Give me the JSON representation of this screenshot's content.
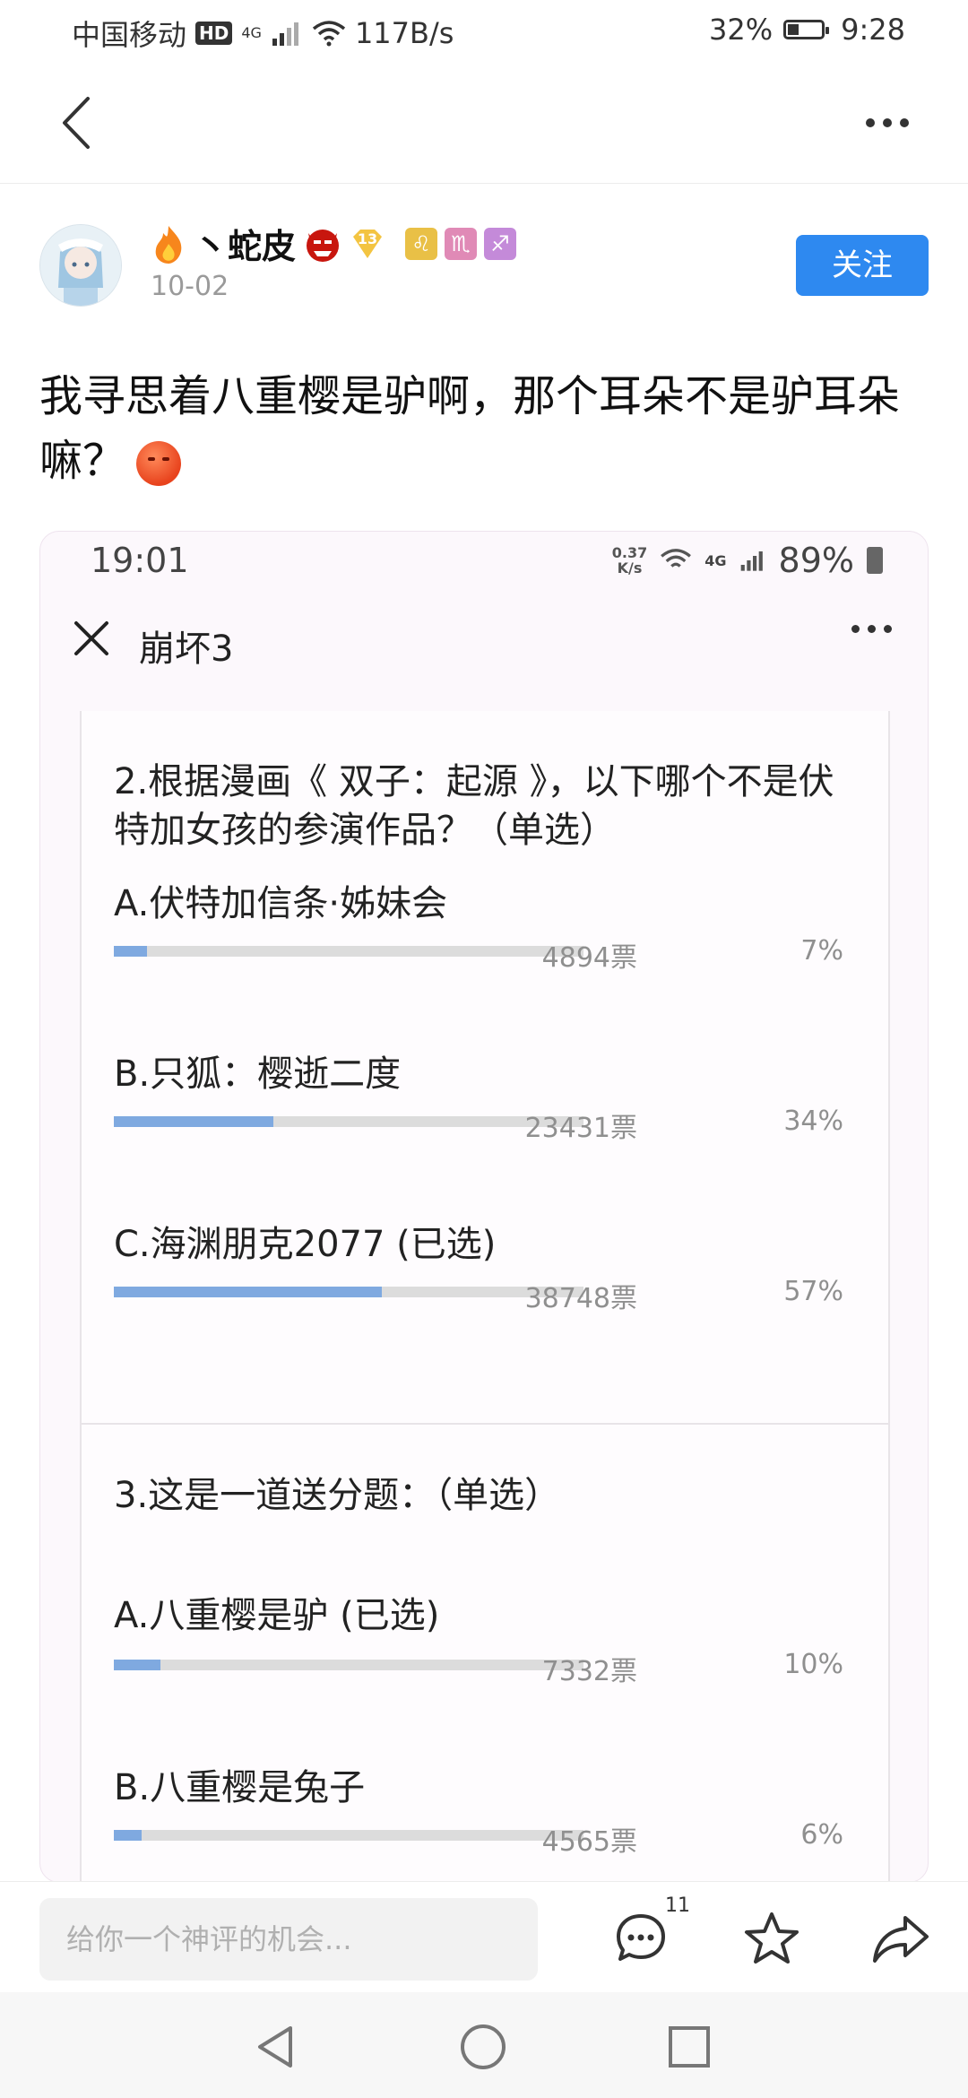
{
  "status_bar": {
    "carrier": "中国移动",
    "hd": "HD",
    "network": "4G",
    "speed": "117B/s",
    "battery_percent": "32%",
    "battery_level": 0.32,
    "time": "9:28"
  },
  "nav": {
    "back_icon": "chevron-left-icon",
    "more_icon": "more-horizontal-icon"
  },
  "author": {
    "name": "丶蛇皮",
    "level": "13",
    "date": "10-02",
    "badges": [
      "♌",
      "♏",
      "♐"
    ],
    "badge_colors": [
      "#e9c046",
      "#e08ab6",
      "#c48ad9"
    ],
    "follow_label": "关注"
  },
  "post": {
    "text": "我寻思着八重樱是驴啊，那个耳朵不是驴耳朵嘛？"
  },
  "embedded": {
    "time": "19:01",
    "net_speed_value": "0.37",
    "net_speed_unit": "K/s",
    "network": "4G",
    "battery": "89%",
    "title": "崩坏3",
    "questions": [
      {
        "title": "2.根据漫画《 双子：起源 》，以下哪个不是伏特加女孩的参演作品？（单选）",
        "options": [
          {
            "label": "A.伏特加信条·姊妹会",
            "votes": "4894票",
            "percent": "7%",
            "fraction": 0.07
          },
          {
            "label": "B.只狐：樱逝二度",
            "votes": "23431票",
            "percent": "34%",
            "fraction": 0.34
          },
          {
            "label": "C.海渊朋克2077 (已选)",
            "votes": "38748票",
            "percent": "57%",
            "fraction": 0.57
          }
        ]
      },
      {
        "title": "3.这是一道送分题：（单选）",
        "options": [
          {
            "label": "A.八重樱是驴 (已选)",
            "votes": "7332票",
            "percent": "10%",
            "fraction": 0.1
          },
          {
            "label": "B.八重樱是兔子",
            "votes": "4565票",
            "percent": "6%",
            "fraction": 0.06
          }
        ]
      }
    ]
  },
  "bottom_bar": {
    "comment_placeholder": "给你一个神评的机会...",
    "comment_count": "11",
    "icons": [
      "comment-icon",
      "star-icon",
      "share-icon"
    ]
  },
  "system_nav": {
    "icons": [
      "back-triangle-icon",
      "home-circle-icon",
      "recents-square-icon"
    ]
  },
  "colors": {
    "accent": "#2e89f0",
    "bar_fill": "#7fa9e0",
    "bar_track": "#dcdcdc"
  }
}
